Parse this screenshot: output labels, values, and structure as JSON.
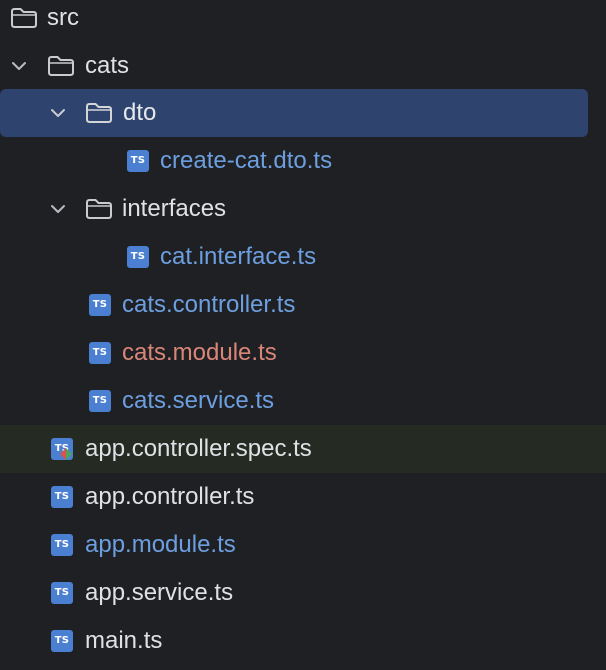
{
  "colors": {
    "background": "#1f2023",
    "selection": "#2e436e",
    "test_row": "#252b22",
    "default_text": "#dfe1e5",
    "modified_text": "#6d9fe0",
    "changed_text": "#d98679",
    "ts_icon": "#4a7fd2"
  },
  "tree": {
    "items": [
      {
        "label": "src",
        "kind": "folder",
        "icon": "folder-icon"
      },
      {
        "label": "cats",
        "kind": "folder",
        "expanded": true,
        "icon": "folder-icon"
      },
      {
        "label": "dto",
        "kind": "folder",
        "expanded": true,
        "selected": true,
        "icon": "folder-icon"
      },
      {
        "label": "create-cat.dto.ts",
        "kind": "file",
        "icon_text": "TS",
        "status": "modified"
      },
      {
        "label": "interfaces",
        "kind": "folder",
        "expanded": true,
        "icon": "folder-icon"
      },
      {
        "label": "cat.interface.ts",
        "kind": "file",
        "icon_text": "TS",
        "status": "modified"
      },
      {
        "label": "cats.controller.ts",
        "kind": "file",
        "icon_text": "TS",
        "status": "modified"
      },
      {
        "label": "cats.module.ts",
        "kind": "file",
        "icon_text": "TS",
        "status": "changed"
      },
      {
        "label": "cats.service.ts",
        "kind": "file",
        "icon_text": "TS",
        "status": "modified"
      },
      {
        "label": "app.controller.spec.ts",
        "kind": "file",
        "icon_text": "TS",
        "status": "default",
        "test": true
      },
      {
        "label": "app.controller.ts",
        "kind": "file",
        "icon_text": "TS",
        "status": "default"
      },
      {
        "label": "app.module.ts",
        "kind": "file",
        "icon_text": "TS",
        "status": "modified"
      },
      {
        "label": "app.service.ts",
        "kind": "file",
        "icon_text": "TS",
        "status": "default"
      },
      {
        "label": "main.ts",
        "kind": "file",
        "icon_text": "TS",
        "status": "default"
      }
    ]
  }
}
